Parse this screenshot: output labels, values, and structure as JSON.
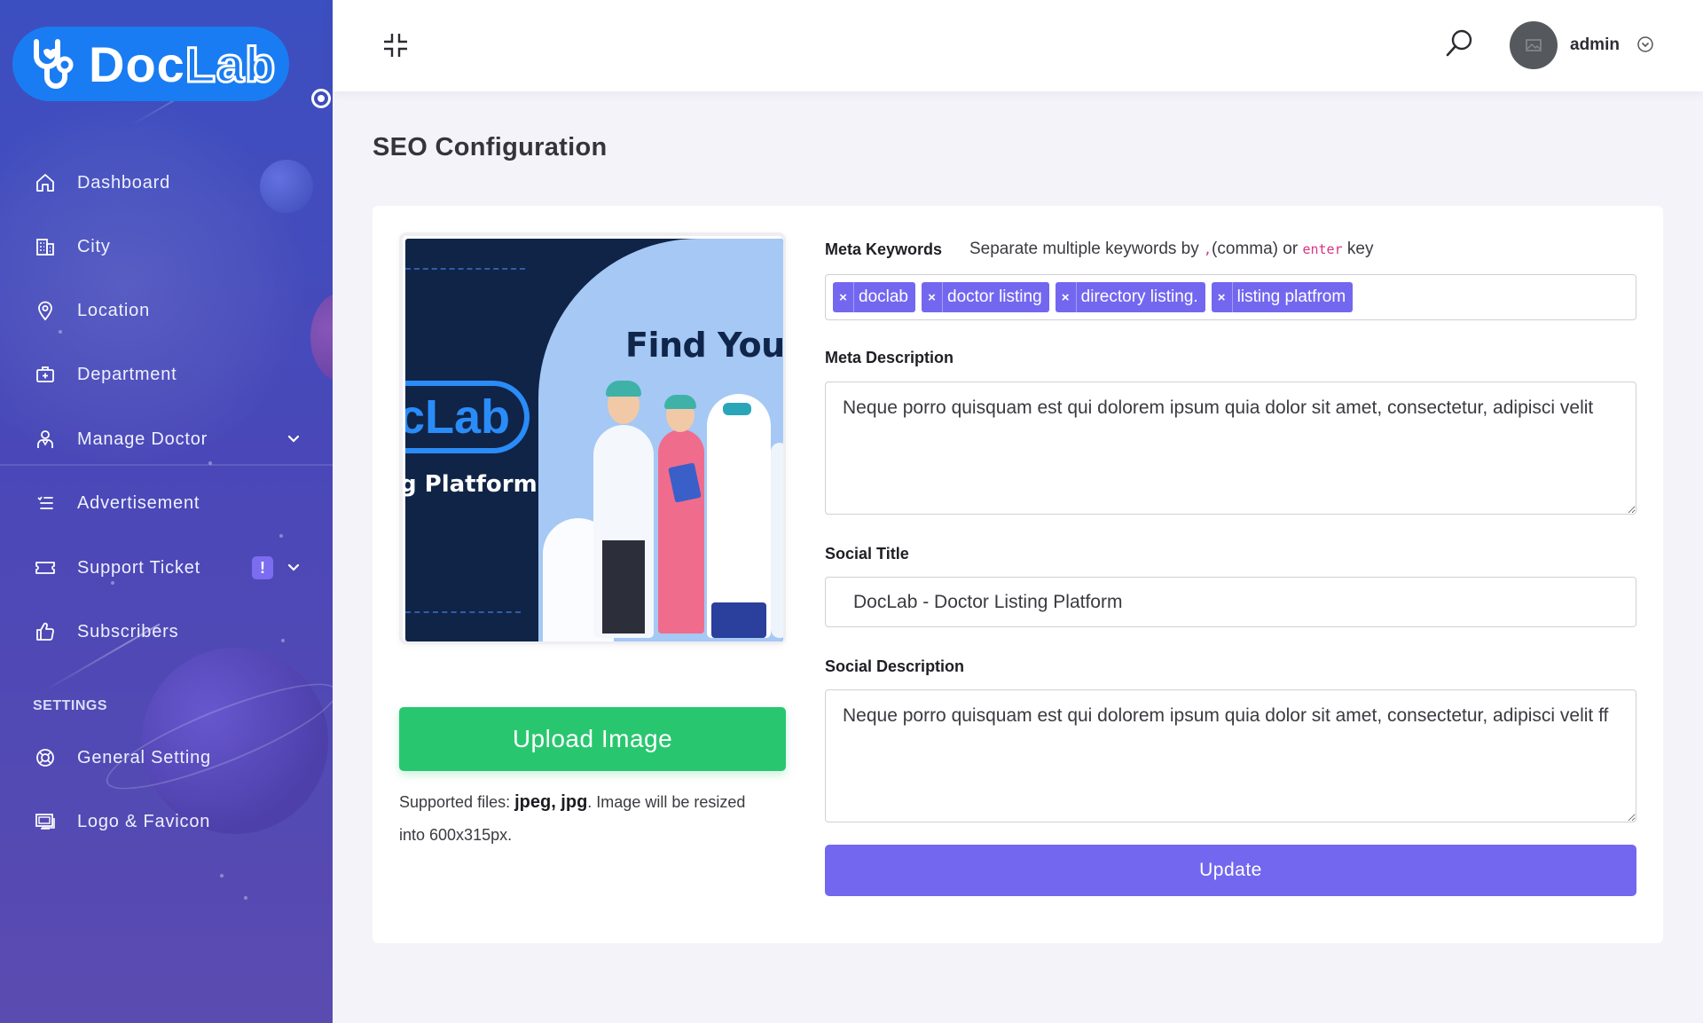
{
  "brand": {
    "logo_doc": "Doc",
    "logo_lab": "Lab"
  },
  "sidebar": {
    "items": [
      {
        "label": "Dashboard",
        "icon": "home-icon"
      },
      {
        "label": "City",
        "icon": "building-icon"
      },
      {
        "label": "Location",
        "icon": "map-pin-icon"
      },
      {
        "label": "Department",
        "icon": "medical-kit-icon"
      },
      {
        "label": "Manage Doctor",
        "icon": "doctor-icon",
        "has_submenu": true
      },
      {
        "label": "Advertisement",
        "icon": "list-icon"
      },
      {
        "label": "Support Ticket",
        "icon": "ticket-icon",
        "has_submenu": true,
        "badge": "!"
      },
      {
        "label": "Subscribers",
        "icon": "thumbs-up-icon"
      }
    ],
    "settings_title": "SETTINGS",
    "settings_items": [
      {
        "label": "General Setting",
        "icon": "lifebuoy-icon"
      },
      {
        "label": "Logo & Favicon",
        "icon": "monitor-icon"
      }
    ]
  },
  "topbar": {
    "user_name": "admin"
  },
  "page": {
    "title": "SEO Configuration"
  },
  "preview": {
    "headline": "Find Your D",
    "brand_text": "cLab",
    "platform_text": "g Platform"
  },
  "upload": {
    "button_label": "Upload Image",
    "note_prefix": "Supported files: ",
    "note_formats": "jpeg, jpg",
    "note_suffix": ". Image will be resized into 600x315px."
  },
  "form": {
    "meta_keywords_label": "Meta Keywords",
    "keywords_hint_prefix": "Separate multiple keywords by ",
    "keywords_hint_comma": ",",
    "keywords_hint_middle": "(comma) or ",
    "keywords_hint_enter": "enter",
    "keywords_hint_suffix": " key",
    "keywords": [
      "doclab",
      "doctor listing",
      "directory listing.",
      "listing platfrom"
    ],
    "meta_description_label": "Meta Description",
    "meta_description": "Neque porro quisquam est qui dolorem ipsum quia dolor sit amet, consectetur, adipisci velit",
    "social_title_label": "Social Title",
    "social_title": "DocLab - Doctor Listing Platform",
    "social_description_label": "Social Description",
    "social_description": "Neque porro quisquam est qui dolorem ipsum quia dolor sit amet, consectetur, adipisci velit ff",
    "update_label": "Update"
  },
  "colors": {
    "primary": "#7367f0",
    "success": "#28c76f",
    "logo_blue": "#1a7cf2",
    "sidebar_top": "#3c4fc0",
    "sidebar_bottom": "#5a4bb0"
  }
}
